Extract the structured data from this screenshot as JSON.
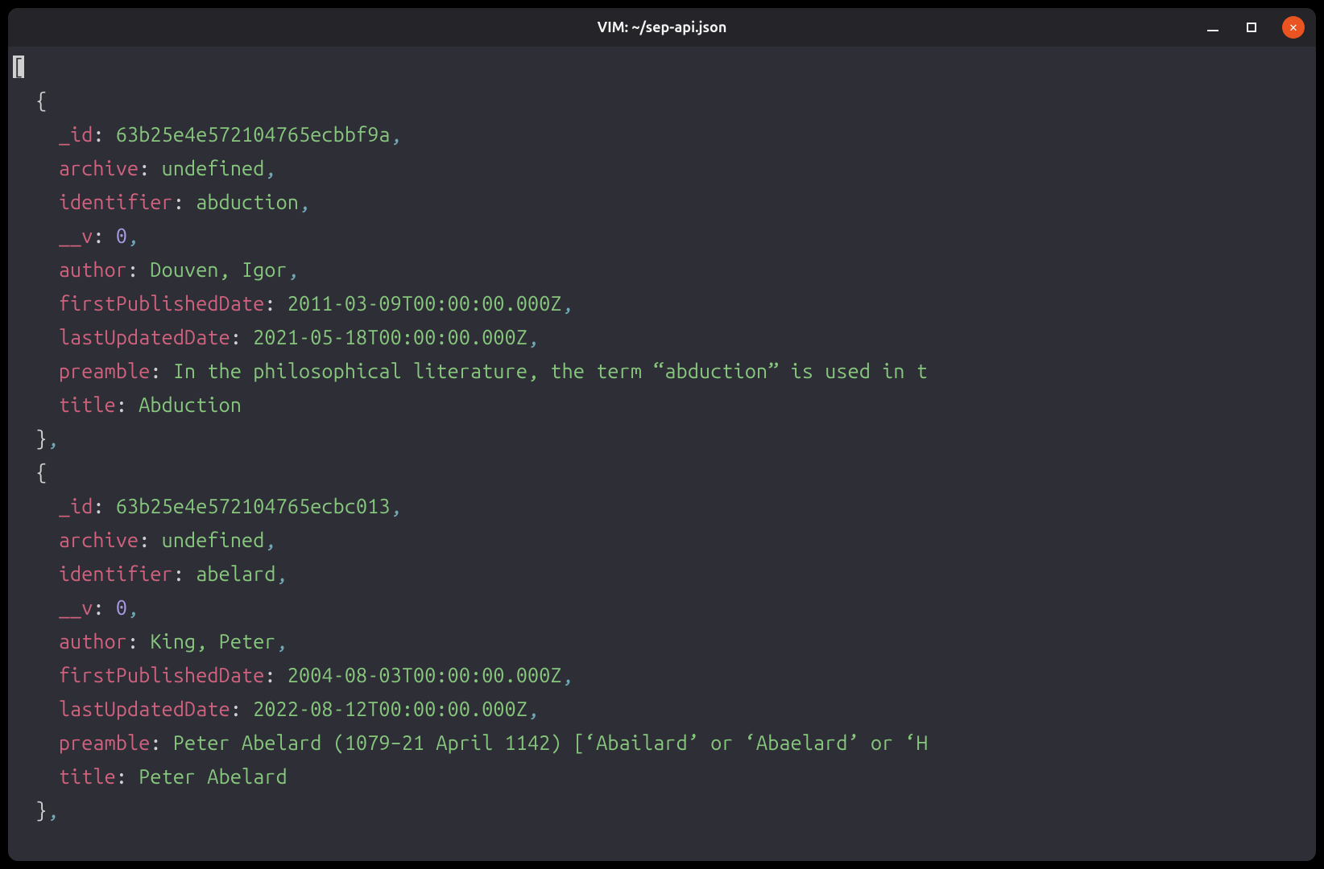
{
  "window": {
    "title": "VIM: ~/sep-api.json"
  },
  "cursor_char": "[",
  "entries": [
    {
      "_id": "63b25e4e572104765ecbbf9a",
      "archive": "undefined",
      "identifier": "abduction",
      "__v": "0",
      "author": "Douven, Igor",
      "firstPublishedDate": "2011-03-09T00:00:00.000Z",
      "lastUpdatedDate": "2021-05-18T00:00:00.000Z",
      "preamble": "In the philosophical literature, the term “abduction” is used in t",
      "title": "Abduction"
    },
    {
      "_id": "63b25e4e572104765ecbc013",
      "archive": "undefined",
      "identifier": "abelard",
      "__v": "0",
      "author": "King, Peter",
      "firstPublishedDate": "2004-08-03T00:00:00.000Z",
      "lastUpdatedDate": "2022-08-12T00:00:00.000Z",
      "preamble": "Peter Abelard (1079–21 April 1142) [‘Abailard’ or ‘Abaelard’ or ‘H",
      "title": "Peter Abelard"
    }
  ],
  "k": {
    "_id": "_id",
    "archive": "archive",
    "identifier": "identifier",
    "__v": "__v",
    "author": "author",
    "firstPublishedDate": "firstPublishedDate",
    "lastUpdatedDate": "lastUpdatedDate",
    "preamble": "preamble",
    "title": "title"
  },
  "sym": {
    "open_brace": "{",
    "close_brace": "}",
    "colon": ":",
    "comma": ",",
    "space": " "
  }
}
